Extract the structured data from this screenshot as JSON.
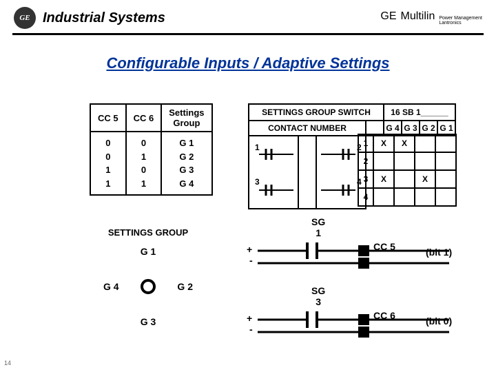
{
  "header": {
    "logo_text": "GE",
    "title": "Industrial Systems",
    "brand1": "GE",
    "brand2": "Multilin",
    "tagline1": "Power Management",
    "tagline2": "Lantronics"
  },
  "page_title": "Configurable Inputs / Adaptive Settings",
  "truth": {
    "h1": "CC 5",
    "h2": "CC 6",
    "h3": "Settings\nGroup",
    "c1": "0\n0\n1\n1",
    "c2": "0\n1\n0\n1",
    "c3": "G 1\nG 2\nG 3\nG 4"
  },
  "sgs": {
    "title": "SETTINGS GROUP SWITCH",
    "model": "16 SB 1______",
    "contact_hdr": "CONTACT NUMBER",
    "g4": "G 4",
    "g3": "G 3",
    "g2": "G 2",
    "g1": "G 1",
    "n1": "1",
    "n2": "2",
    "n3": "3",
    "n4": "4",
    "sw1": "1",
    "sw2": "2",
    "sw3": "3",
    "sw4": "4",
    "x": "X"
  },
  "dial": {
    "title": "SETTINGS GROUP",
    "g1": "G 1",
    "g2": "G 2",
    "g3": "G 3",
    "g4": "G 4"
  },
  "circ": {
    "sg1": "SG\n1",
    "sg3": "SG\n3",
    "plus": "+",
    "minus": "-",
    "cc5": "CC 5",
    "cc6": "CC 6",
    "bit1": "(bit 1)",
    "bit0": "(bit 0)"
  },
  "slide_num": "14"
}
